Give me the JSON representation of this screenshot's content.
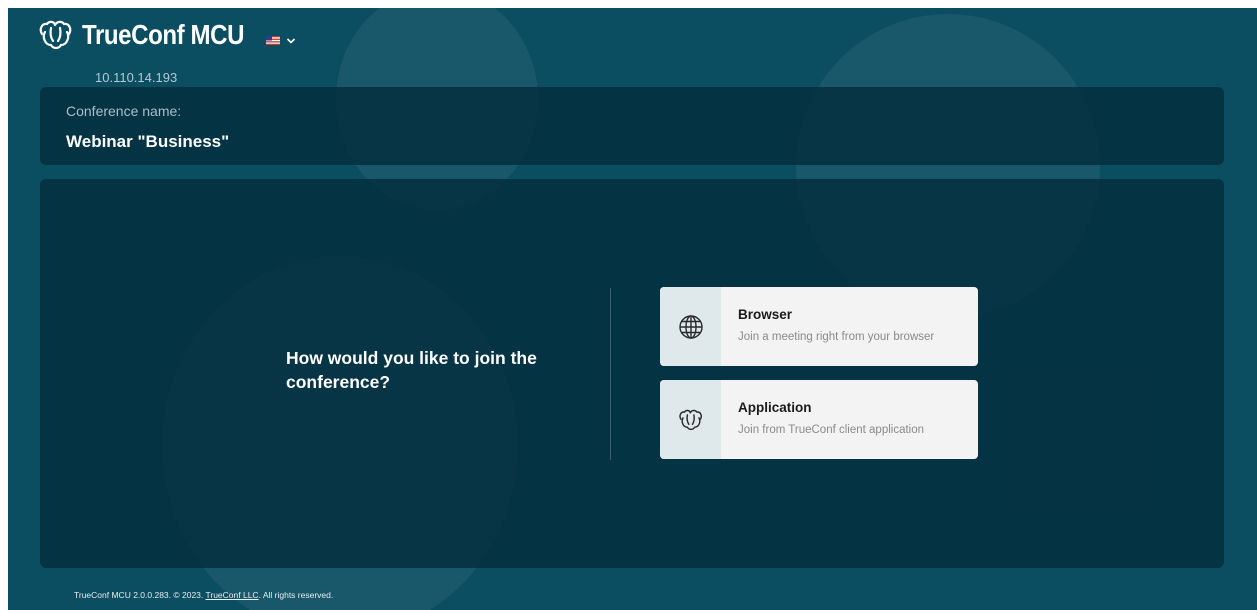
{
  "header": {
    "logo_icon": "trueconf-logo-icon",
    "product_name": "TrueConf MCU",
    "server_ip": "10.110.14.193",
    "language": {
      "flag": "us-flag-icon",
      "chevron": "chevron-down-icon"
    }
  },
  "conference": {
    "label": "Conference name:",
    "name": "Webinar \"Business\""
  },
  "join": {
    "question": "How would you like to join the conference?",
    "options": [
      {
        "icon": "globe-icon",
        "title": "Browser",
        "description": "Join a meeting right from your browser"
      },
      {
        "icon": "trueconf-app-icon",
        "title": "Application",
        "description": "Join from TrueConf client application"
      }
    ]
  },
  "footer": {
    "prefix": "TrueConf MCU 2.0.0.283. © 2023.",
    "company_link": "TrueConf LLC",
    "suffix": "All rights reserved."
  },
  "colors": {
    "background": "#0b4d61",
    "card": "#032c3c",
    "option_bg": "#f3f3f3",
    "option_icon_bg": "#dfe8eb"
  }
}
